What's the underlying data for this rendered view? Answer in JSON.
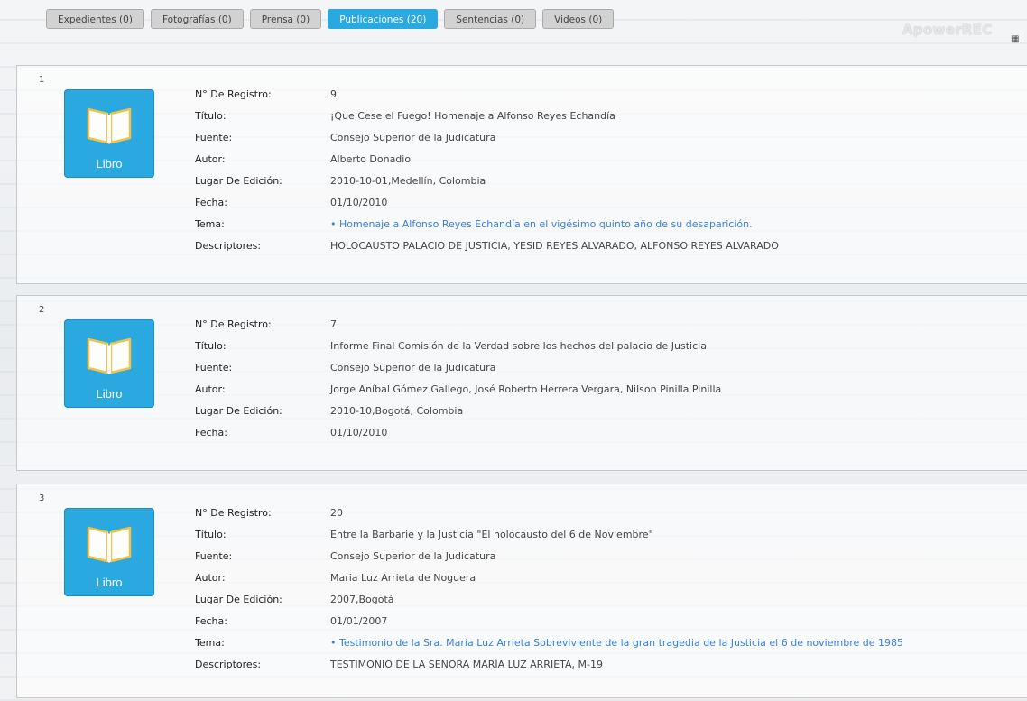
{
  "tabs": [
    {
      "label": "Expedientes (0)",
      "active": false
    },
    {
      "label": "Fotografías (0)",
      "active": false
    },
    {
      "label": "Prensa (0)",
      "active": false
    },
    {
      "label": "Publicaciones (20)",
      "active": true
    },
    {
      "label": "Sentencias (0)",
      "active": false
    },
    {
      "label": "Videos (0)",
      "active": false
    }
  ],
  "watermark": "ApowerREC",
  "labels": {
    "registro": "N° De Registro:",
    "titulo": "Título:",
    "fuente": "Fuente:",
    "autor": "Autor:",
    "lugar": "Lugar De Edición:",
    "fecha": "Fecha:",
    "tema": "Tema:",
    "descriptores": "Descriptores:"
  },
  "book_label": "Libro",
  "records": [
    {
      "index": "1",
      "registro": "9",
      "titulo": "¡Que Cese el Fuego! Homenaje a Alfonso Reyes Echandía",
      "fuente": "Consejo Superior de la Judicatura",
      "autor": "Alberto Donadio",
      "lugar": "2010-10-01,Medellín, Colombia",
      "fecha": "01/10/2010",
      "tema": "• Homenaje a Alfonso Reyes Echandía en el vigésimo quinto año de su desaparición.",
      "descriptores": "HOLOCAUSTO PALACIO DE JUSTICIA, YESID REYES ALVARADO, ALFONSO REYES ALVARADO"
    },
    {
      "index": "2",
      "registro": "7",
      "titulo": "Informe Final Comisión de la Verdad sobre los hechos del palacio de Justicia",
      "fuente": "Consejo Superior de la Judicatura",
      "autor": "Jorge Aníbal Gómez Gallego, José Roberto Herrera Vergara, Nilson Pinilla Pinilla",
      "lugar": "2010-10,Bogotá, Colombia",
      "fecha": "01/10/2010"
    },
    {
      "index": "3",
      "registro": "20",
      "titulo": "Entre la Barbarie y la Justicia \"El holocausto del 6 de Noviembre\"",
      "fuente": "Consejo Superior de la Judicatura",
      "autor": "Maria Luz Arrieta de Noguera",
      "lugar": "2007,Bogotá",
      "fecha": "01/01/2007",
      "tema": "• Testimonio de la Sra. María Luz Arrieta Sobreviviente de la gran tragedia de la Justicia el 6 de noviembre de 1985",
      "descriptores": "TESTIMONIO DE LA SEÑORA MARÍA LUZ ARRIETA, M-19"
    }
  ]
}
